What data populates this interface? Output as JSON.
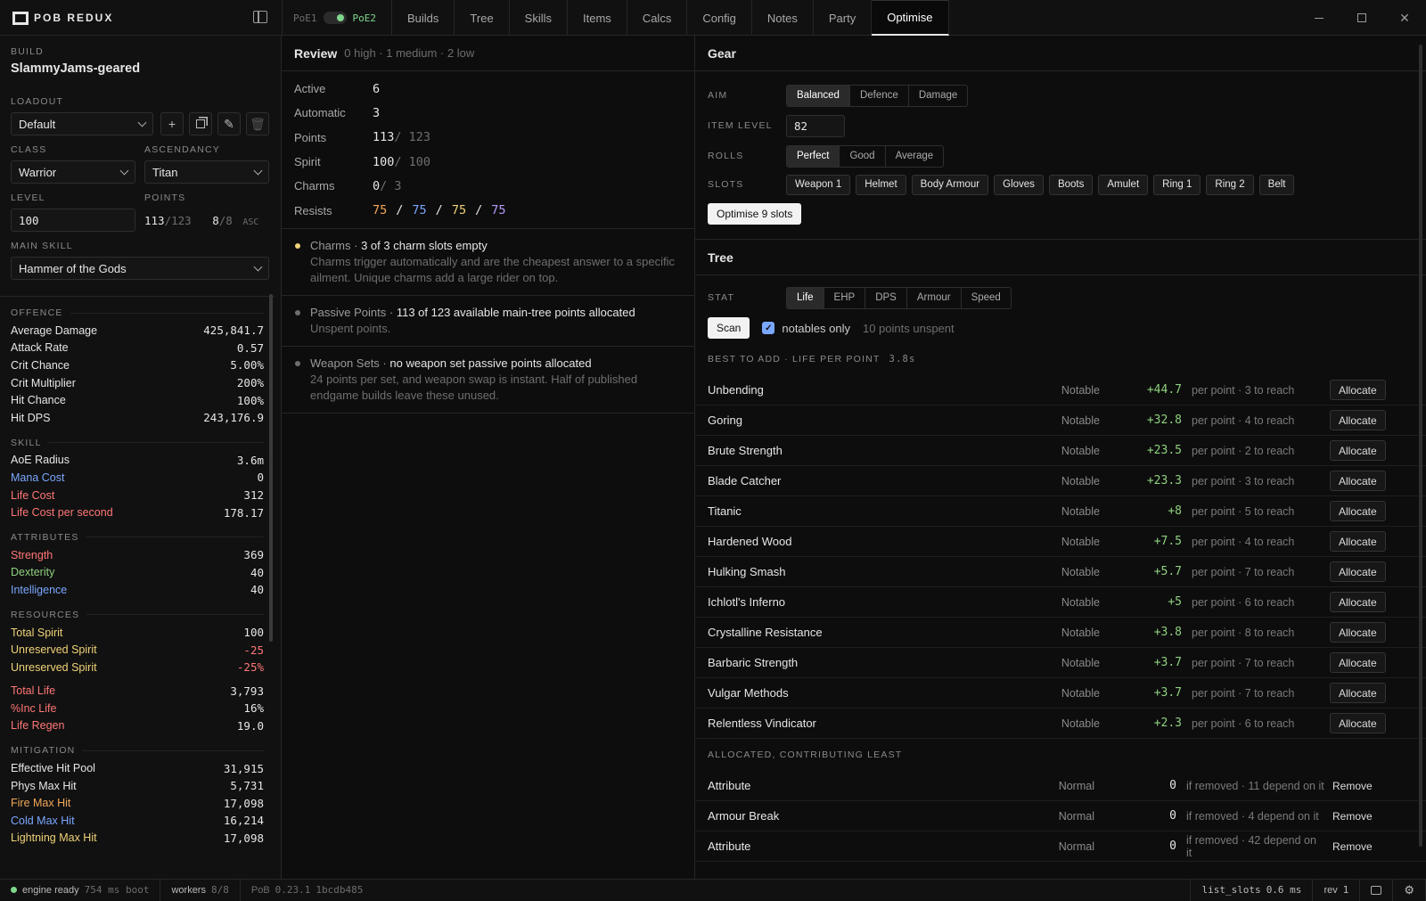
{
  "app": {
    "name": "POB REDUX"
  },
  "game": {
    "left": "PoE1",
    "right": "PoE2"
  },
  "tabs": [
    "Builds",
    "Tree",
    "Skills",
    "Items",
    "Calcs",
    "Config",
    "Notes",
    "Party",
    "Optimise"
  ],
  "active_tab": "Optimise",
  "window": {
    "minimize": "—",
    "maximize": "☐",
    "close": "✕"
  },
  "left": {
    "build_label": "BUILD",
    "build_name": "SlammyJams-geared",
    "loadout_label": "LOADOUT",
    "loadout_value": "Default",
    "class_label": "CLASS",
    "class_value": "Warrior",
    "ascendancy_label": "ASCENDANCY",
    "ascendancy_value": "Titan",
    "level_label": "LEVEL",
    "level_value": "100",
    "points_label": "POINTS",
    "points_used": "113",
    "points_total": "/123",
    "asc_used": "8",
    "asc_total": "/8",
    "asc_suffix": "ASC",
    "main_skill_label": "MAIN SKILL",
    "main_skill_value": "Hammer of the Gods",
    "sections": [
      {
        "title": "OFFENCE",
        "rows": [
          {
            "k": "Average Damage",
            "v": "425,841.7",
            "c": ""
          },
          {
            "k": "Attack Rate",
            "v": "0.57",
            "c": ""
          },
          {
            "k": "Crit Chance",
            "v": "5.00%",
            "c": ""
          },
          {
            "k": "Crit Multiplier",
            "v": "200%",
            "c": ""
          },
          {
            "k": "Hit Chance",
            "v": "100%",
            "c": ""
          },
          {
            "k": "Hit DPS",
            "v": "243,176.9",
            "c": ""
          }
        ]
      },
      {
        "title": "SKILL",
        "rows": [
          {
            "k": "AoE Radius",
            "v": "3.6m",
            "c": ""
          },
          {
            "k": "Mana Cost",
            "v": "0",
            "c": "c-blue"
          },
          {
            "k": "Life Cost",
            "v": "312",
            "c": "c-red"
          },
          {
            "k": "Life Cost per second",
            "v": "178.17",
            "c": "c-red"
          }
        ]
      },
      {
        "title": "ATTRIBUTES",
        "rows": [
          {
            "k": "Strength",
            "v": "369",
            "c": "c-red"
          },
          {
            "k": "Dexterity",
            "v": "40",
            "c": "c-green"
          },
          {
            "k": "Intelligence",
            "v": "40",
            "c": "c-blue"
          }
        ]
      },
      {
        "title": "RESOURCES",
        "rows": [
          {
            "k": "Total Spirit",
            "v": "100",
            "c": "c-yellow"
          },
          {
            "k": "Unreserved Spirit",
            "v": "-25",
            "c": "c-yellow",
            "vc": "c-red"
          },
          {
            "k": "Unreserved Spirit",
            "v": "-25%",
            "c": "c-yellow",
            "vc": "c-red"
          },
          {
            "k": "Total Life",
            "v": "3,793",
            "c": "c-red",
            "gap": true
          },
          {
            "k": "%Inc Life",
            "v": "16%",
            "c": "c-red"
          },
          {
            "k": "Life Regen",
            "v": "19.0",
            "c": "c-red"
          }
        ]
      },
      {
        "title": "MITIGATION",
        "rows": [
          {
            "k": "Effective Hit Pool",
            "v": "31,915",
            "c": ""
          },
          {
            "k": "Phys Max Hit",
            "v": "5,731",
            "c": ""
          },
          {
            "k": "Fire Max Hit",
            "v": "17,098",
            "c": "c-orange"
          },
          {
            "k": "Cold Max Hit",
            "v": "16,214",
            "c": "c-blue"
          },
          {
            "k": "Lightning Max Hit",
            "v": "17,098",
            "c": "c-yellow"
          }
        ]
      }
    ]
  },
  "review": {
    "title": "Review",
    "summary": "0 high · 1 medium · 2 low",
    "rows": [
      {
        "k": "Active",
        "v": "6",
        "rest": ""
      },
      {
        "k": "Automatic",
        "v": "3",
        "rest": ""
      },
      {
        "k": "Points",
        "v": "113",
        "rest": "/ 123"
      },
      {
        "k": "Spirit",
        "v": "100",
        "rest": "/ 100"
      },
      {
        "k": "Charms",
        "v": "0",
        "rest": "/ 3"
      }
    ],
    "resists_label": "Resists",
    "resists": [
      "75",
      "75",
      "75",
      "75"
    ],
    "resists_sep": "/",
    "issues": [
      {
        "head": "Charms",
        "title": "3 of 3 charm slots empty",
        "body": "Charms trigger automatically and are the cheapest answer to a specific ailment. Unique charms add a large rider on top.",
        "color": "#f0d278"
      },
      {
        "head": "Passive Points",
        "title": "113 of 123 available main-tree points allocated",
        "body": "Unspent points.",
        "color": "#6e6e6e"
      },
      {
        "head": "Weapon Sets",
        "title": "no weapon set passive points allocated",
        "body": "24 points per set, and weapon swap is instant. Half of published endgame builds leave these unused.",
        "color": "#6e6e6e"
      }
    ]
  },
  "gear": {
    "title": "Gear",
    "aim_label": "AIM",
    "aim_options": [
      "Balanced",
      "Defence",
      "Damage"
    ],
    "aim_selected": "Balanced",
    "item_level_label": "ITEM LEVEL",
    "item_level": "82",
    "rolls_label": "ROLLS",
    "rolls_options": [
      "Perfect",
      "Good",
      "Average"
    ],
    "rolls_selected": "Perfect",
    "slots_label": "SLOTS",
    "slots": [
      "Weapon 1",
      "Helmet",
      "Body Armour",
      "Gloves",
      "Boots",
      "Amulet",
      "Ring 1",
      "Ring 2",
      "Belt"
    ],
    "optimise_button": "Optimise 9 slots"
  },
  "tree": {
    "title": "Tree",
    "stat_label": "STAT",
    "stat_options": [
      "Life",
      "EHP",
      "DPS",
      "Armour",
      "Speed"
    ],
    "stat_selected": "Life",
    "scan_button": "Scan",
    "notables_label": "notables only",
    "unspent": "10 points unspent",
    "best_header": "BEST TO ADD · LIFE PER POINT",
    "best_time": "3.8s",
    "best": [
      {
        "name": "Unbending",
        "type": "Notable",
        "gain": "+44.7",
        "desc": "per point · 3 to reach"
      },
      {
        "name": "Goring",
        "type": "Notable",
        "gain": "+32.8",
        "desc": "per point · 4 to reach"
      },
      {
        "name": "Brute Strength",
        "type": "Notable",
        "gain": "+23.5",
        "desc": "per point · 2 to reach"
      },
      {
        "name": "Blade Catcher",
        "type": "Notable",
        "gain": "+23.3",
        "desc": "per point · 3 to reach"
      },
      {
        "name": "Titanic",
        "type": "Notable",
        "gain": "+8",
        "desc": "per point · 5 to reach"
      },
      {
        "name": "Hardened Wood",
        "type": "Notable",
        "gain": "+7.5",
        "desc": "per point · 4 to reach"
      },
      {
        "name": "Hulking Smash",
        "type": "Notable",
        "gain": "+5.7",
        "desc": "per point · 7 to reach"
      },
      {
        "name": "Ichlotl's Inferno",
        "type": "Notable",
        "gain": "+5",
        "desc": "per point · 6 to reach"
      },
      {
        "name": "Crystalline Resistance",
        "type": "Notable",
        "gain": "+3.8",
        "desc": "per point · 8 to reach"
      },
      {
        "name": "Barbaric Strength",
        "type": "Notable",
        "gain": "+3.7",
        "desc": "per point · 7 to reach"
      },
      {
        "name": "Vulgar Methods",
        "type": "Notable",
        "gain": "+3.7",
        "desc": "per point · 7 to reach"
      },
      {
        "name": "Relentless Vindicator",
        "type": "Notable",
        "gain": "+2.3",
        "desc": "per point · 6 to reach"
      }
    ],
    "allocate_label": "Allocate",
    "least_header": "ALLOCATED, CONTRIBUTING LEAST",
    "least": [
      {
        "name": "Attribute",
        "type": "Normal",
        "gain": "0",
        "desc": "if removed · 11 depend on it"
      },
      {
        "name": "Armour Break",
        "type": "Normal",
        "gain": "0",
        "desc": "if removed · 4 depend on it"
      },
      {
        "name": "Attribute",
        "type": "Normal",
        "gain": "0",
        "desc": "if removed · 42 depend on it"
      }
    ],
    "remove_label": "Remove"
  },
  "status": {
    "engine": "engine ready",
    "boot": "754 ms boot",
    "workers_label": "workers",
    "workers": "8/8",
    "pob_label": "PoB",
    "version": "0.23.1",
    "hash": "1bcdb485",
    "call": "list_slots",
    "call_time": "0.6 ms",
    "rev_label": "rev",
    "rev": "1"
  },
  "colors": {
    "accent_green": "#7ed88b",
    "gain": "#8fd17f",
    "fire": "#f3a85a",
    "cold": "#7aa7ff",
    "lightning": "#f0d278"
  }
}
